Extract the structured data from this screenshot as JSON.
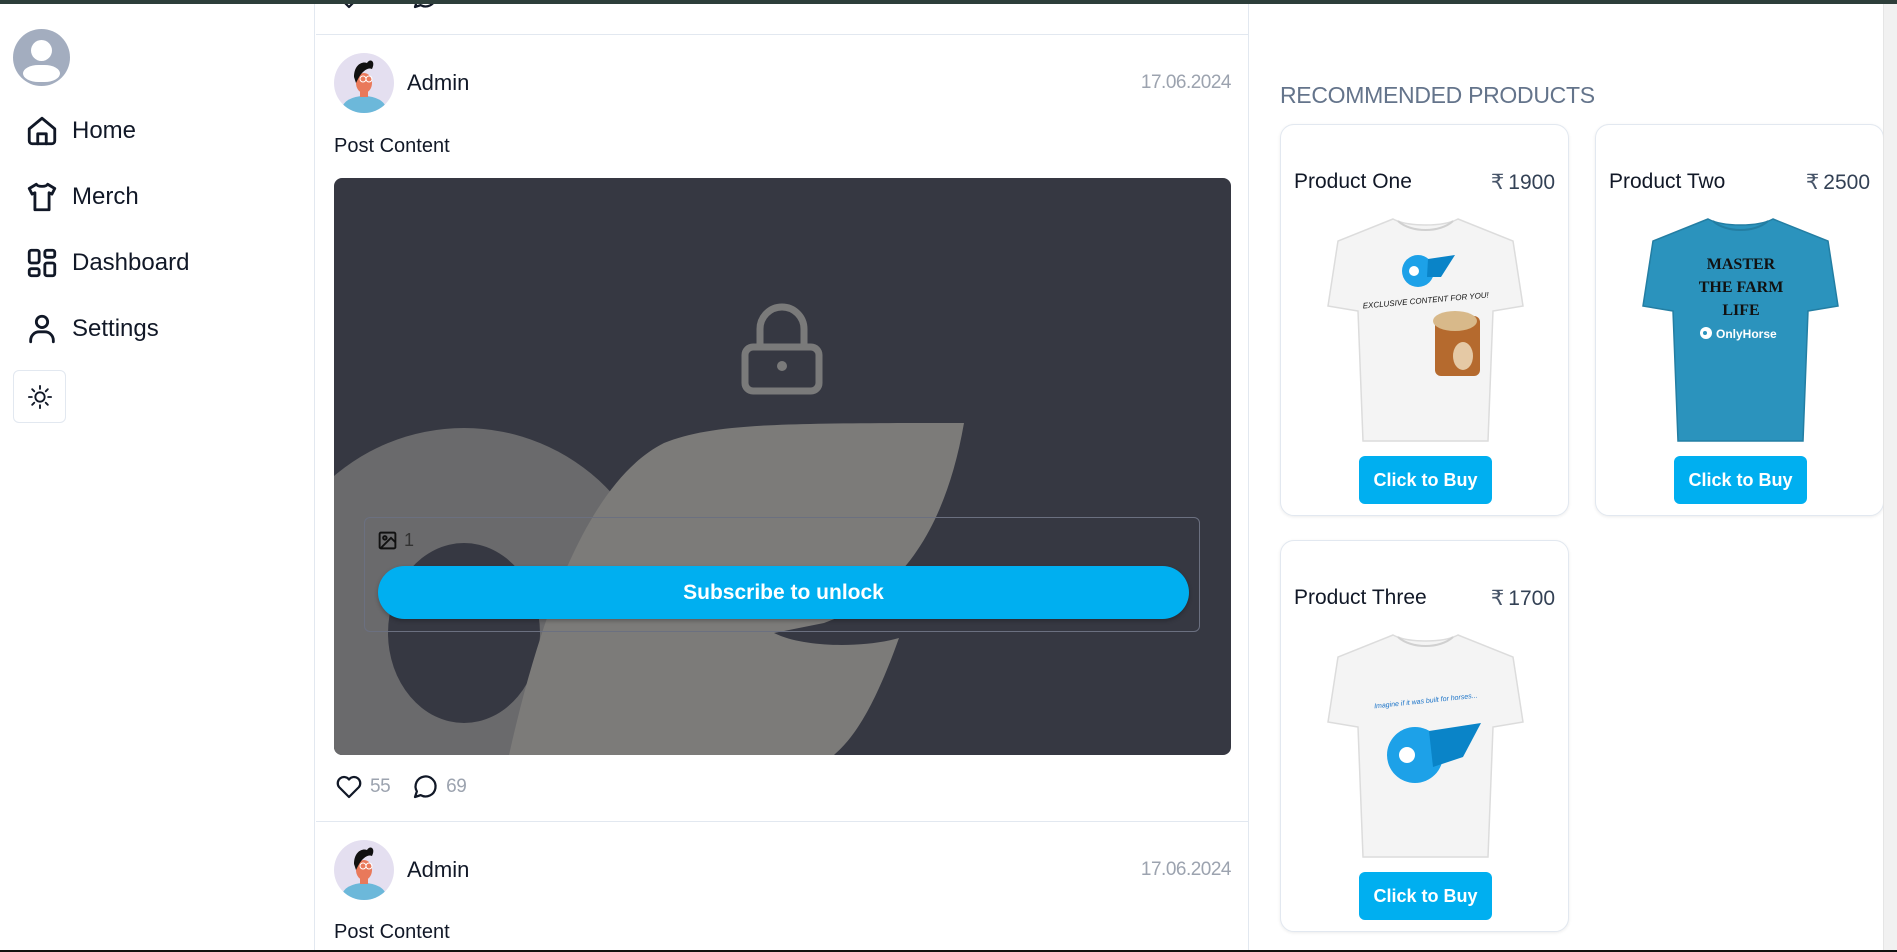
{
  "sidebar": {
    "avatar_icon": "user-avatar-placeholder",
    "items": [
      {
        "label": "Home",
        "icon": "home-icon"
      },
      {
        "label": "Merch",
        "icon": "tshirt-icon"
      },
      {
        "label": "Dashboard",
        "icon": "dashboard-icon"
      },
      {
        "label": "Settings",
        "icon": "user-icon"
      }
    ],
    "theme_toggle_icon": "sun-icon"
  },
  "feed": {
    "previous_post": {
      "likes": "55",
      "comments": "69"
    },
    "posts": [
      {
        "author": "Admin",
        "date": "17.06.2024",
        "content": "Post Content",
        "locked": true,
        "media_count": "1",
        "subscribe_label": "Subscribe to unlock",
        "likes": "55",
        "comments": "69"
      },
      {
        "author": "Admin",
        "date": "17.06.2024",
        "content": "Post Content"
      }
    ]
  },
  "recommended": {
    "title": "RECOMMENDED PRODUCTS",
    "currency_symbol": "₹",
    "products": [
      {
        "name": "Product One",
        "price": "1900",
        "buy_label": "Click to Buy",
        "shirt_color": "#f4f4f4",
        "print_text": "EXCLUSIVE CONTENT FOR YOU!"
      },
      {
        "name": "Product Two",
        "price": "2500",
        "buy_label": "Click to Buy",
        "shirt_color": "#2b93bd",
        "print_lines": [
          "MASTER",
          "THE FARM",
          "LIFE"
        ],
        "brand": "OnlyHorse"
      },
      {
        "name": "Product Three",
        "price": "1700",
        "buy_label": "Click to Buy",
        "shirt_color": "#f4f4f4",
        "print_text": "Imagine if it was built for horses..."
      }
    ]
  },
  "colors": {
    "accent": "#00aff0",
    "locked_bg": "#363842",
    "muted_text": "#9ca3af",
    "title_text": "#64748b"
  }
}
